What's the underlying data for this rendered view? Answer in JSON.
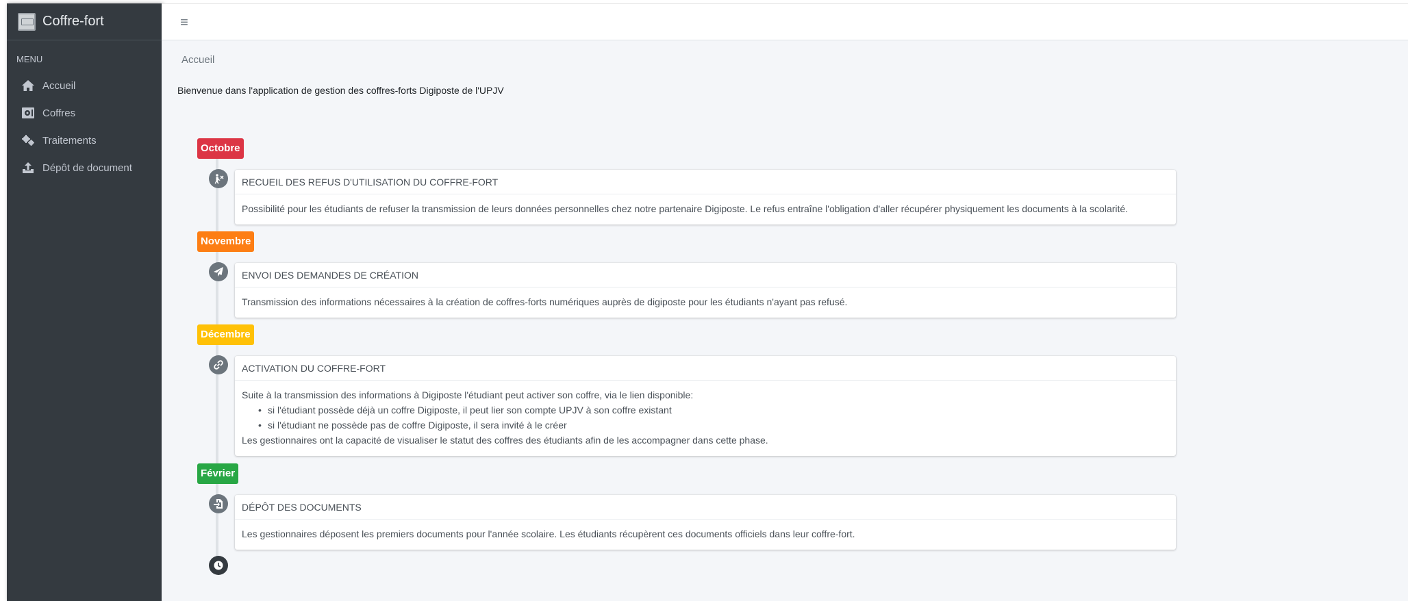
{
  "brand": {
    "title": "Coffre-fort"
  },
  "sidebar": {
    "header": "MENU",
    "items": [
      {
        "label": "Accueil",
        "icon": "home-icon"
      },
      {
        "label": "Coffres",
        "icon": "vault-icon"
      },
      {
        "label": "Traitements",
        "icon": "cogs-icon"
      },
      {
        "label": "Dépôt de document",
        "icon": "upload-icon"
      }
    ]
  },
  "topbar": {
    "toggle_icon": "hamburger-icon"
  },
  "breadcrumb": "Accueil",
  "welcome": "Bienvenue dans l'application de gestion des coffres-forts Digiposte de l'UPJV",
  "colors": {
    "sidebar_bg": "#343a40",
    "content_bg": "#f4f6f9",
    "badge_october": "#dc3545",
    "badge_november": "#fd7e14",
    "badge_december": "#ffc107",
    "badge_february": "#28a745"
  },
  "timeline": [
    {
      "month": "Octobre",
      "icon": "person-refuse-icon",
      "title": "RECUEIL DES REFUS D'UTILISATION DU COFFRE-FORT",
      "text": "Possibilité pour les étudiants de refuser la transmission de leurs données personnelles chez notre partenaire Digiposte. Le refus entraîne l'obligation d'aller récupérer physiquement les documents à la scolarité."
    },
    {
      "month": "Novembre",
      "icon": "paper-plane-icon",
      "title": "ENVOI DES DEMANDES DE CRÉATION",
      "text": "Transmission des informations nécessaires à la création de coffres-forts numériques auprès de digiposte pour les étudiants n'ayant pas refusé."
    },
    {
      "month": "Décembre",
      "icon": "link-icon",
      "title": "ACTIVATION DU COFFRE-FORT",
      "intro": "Suite à la transmission des informations à Digiposte l'étudiant peut activer son coffre, via le lien disponible:",
      "bullets": [
        "si l'étudiant possède déjà un coffre Digiposte, il peut lier son compte UPJV à son coffre existant",
        "si l'étudiant ne possède pas de coffre Digiposte, il sera invité à le créer"
      ],
      "outro": "Les gestionnaires ont la capacité de visualiser le statut des coffres des étudiants afin de les accompagner dans cette phase."
    },
    {
      "month": "Février",
      "icon": "file-import-icon",
      "title": "DÉPÔT DES DOCUMENTS",
      "text": "Les gestionnaires déposent les premiers documents pour l'année scolaire. Les étudiants récupèrent ces documents officiels dans leur coffre-fort."
    }
  ],
  "timeline_end_icon": "clock-icon"
}
